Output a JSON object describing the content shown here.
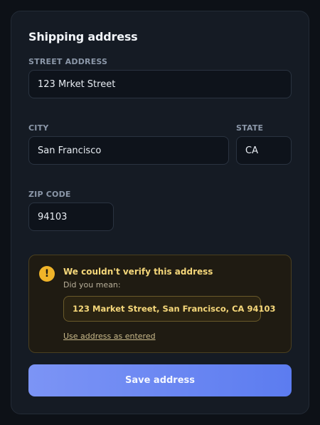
{
  "form": {
    "title": "Shipping address",
    "street": {
      "label": "STREET ADDRESS",
      "value": "123 Mrket Street"
    },
    "city": {
      "label": "CITY",
      "value": "San Francisco"
    },
    "state": {
      "label": "STATE",
      "value": "CA"
    },
    "zip": {
      "label": "ZIP CODE",
      "value": "94103"
    }
  },
  "alert": {
    "icon": "warning-icon",
    "icon_glyph": "!",
    "title": "We couldn't verify this address",
    "subtitle": "Did you mean:",
    "suggestion": "123 Market Street, San Francisco, CA 94103",
    "use_entered_label": "Use address as entered",
    "accent_color": "#f0b429"
  },
  "actions": {
    "save_label": "Save address",
    "button_color": "#6b88f3"
  }
}
